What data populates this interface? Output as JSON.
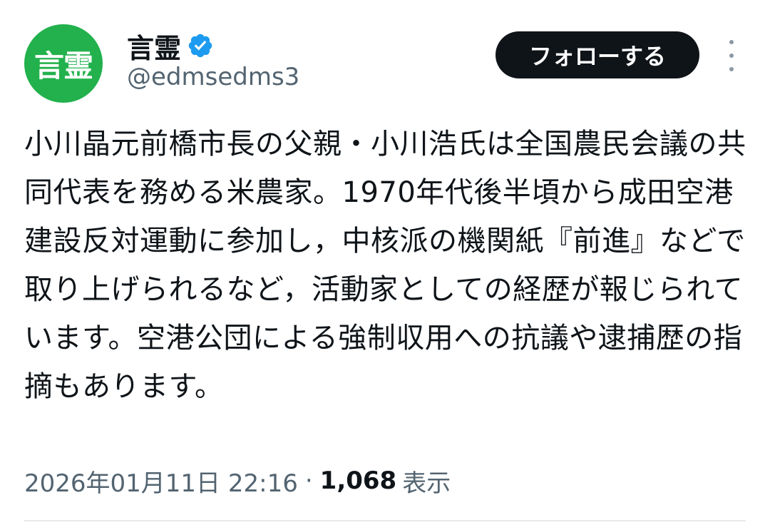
{
  "author": {
    "avatar_text": "言霊",
    "avatar_color": "#22b14c",
    "display_name": "言霊",
    "verified_icon": "verified-badge-icon",
    "verified_color": "#1d9bf0",
    "handle": "@edmsedms3"
  },
  "actions": {
    "follow_label": "フォローする",
    "more_icon": "more-vertical-icon"
  },
  "tweet": {
    "text": "小川晶元前橋市長の父親・小川浩氏は全国農民会議の共同代表を務める米農家。1970年代後半頃から成田空港建設反対運動に参加し，中核派の機関紙『前進』などで取り上げられるなど，活動家としての経歴が報じられています。空港公団による強制収用への抗議や逮捕歴の指摘もあります。"
  },
  "meta": {
    "timestamp": "2026年01月11日 22:16",
    "separator": "·",
    "views_count": "1,068",
    "views_label": "表示"
  }
}
